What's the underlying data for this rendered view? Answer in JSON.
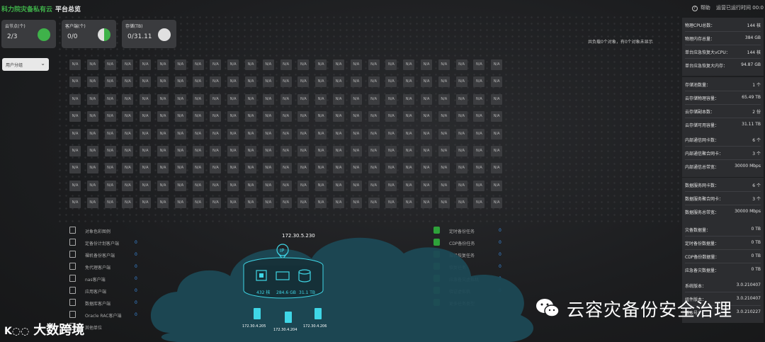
{
  "header": {
    "brand": "科力院灾备私有云",
    "subtitle": "平台总览",
    "help_label": "帮助",
    "runtime_label": "运营已运行时间 00:0"
  },
  "cards": [
    {
      "label": "云节点(个)",
      "value": "2/3",
      "pie_color": "#3fb24a",
      "pie_fraction": 1.0
    },
    {
      "label": "客户端(个)",
      "value": "0/0",
      "pie_color": "#3fb24a",
      "pie_fraction": 0.5
    },
    {
      "label": "存储(TB)",
      "value": "0/31.11",
      "pie_color": "#e0e0e0",
      "pie_fraction": 1.0
    }
  ],
  "notice": "共负载0个对象，有0个对象未显示",
  "tenant_select": {
    "value": "用户分组"
  },
  "grid": {
    "cell_label": "N/A",
    "rows": 9,
    "cols": 25
  },
  "legend_left": [
    {
      "label": "对象色彩图例",
      "count": ""
    },
    {
      "label": "定备份计划客户端",
      "count": "0"
    },
    {
      "label": "裸机备份客户端",
      "count": "0"
    },
    {
      "label": "免代理客户端",
      "count": "0"
    },
    {
      "label": "nas客户端",
      "count": "0"
    },
    {
      "label": "应用客户端",
      "count": "0"
    },
    {
      "label": "数据库客户端",
      "count": "0"
    },
    {
      "label": "Oracle RAC客户端",
      "count": "0"
    },
    {
      "label": "其他单位",
      "count": ""
    }
  ],
  "legend_right": [
    {
      "label": "定时备份任务",
      "count": "0"
    },
    {
      "label": "CDP备份任务",
      "count": "0"
    },
    {
      "label": "裸机恢复任务",
      "count": "0"
    },
    {
      "label": "恢复任务",
      "count": "0"
    },
    {
      "label": "应急备灾虚拟机",
      "count": "0"
    },
    {
      "label": "验证虚拟机",
      "count": "0"
    },
    {
      "label": "更多任务类型",
      "count": ""
    }
  ],
  "right_panel": {
    "group1": [
      {
        "k": "物理CPU总数：",
        "v": "144 核"
      },
      {
        "k": "物理内存总量：",
        "v": "384 GB"
      },
      {
        "k": "单台应急恢复大vCPU：",
        "v": "144 核"
      },
      {
        "k": "单台应急恢复大内存：",
        "v": "94.87 GB"
      }
    ],
    "group2": [
      {
        "k": "存储池数量：",
        "v": "1 个"
      },
      {
        "k": "云存储物理容量：",
        "v": "65.49 TB"
      },
      {
        "k": "云存储副本数：",
        "v": "2 份"
      },
      {
        "k": "云存储可用容量：",
        "v": "31.11 TB"
      }
    ],
    "group3": [
      {
        "k": "内部通信网卡数：",
        "v": "6 个"
      },
      {
        "k": "内部通信聚合网卡：",
        "v": "3 个"
      },
      {
        "k": "内部通信总带宽：",
        "v": "30000 Mbps"
      }
    ],
    "group4": [
      {
        "k": "数据服务网卡数：",
        "v": "6 个"
      },
      {
        "k": "数据服务聚合网卡：",
        "v": "3 个"
      },
      {
        "k": "数据服务总带宽：",
        "v": "30000 Mbps"
      }
    ],
    "group5": [
      {
        "k": "灾备数据量：",
        "v": "0 TB"
      },
      {
        "k": "定时备份数据量：",
        "v": "0 TB"
      },
      {
        "k": "CDP备份数据量：",
        "v": "0 TB"
      },
      {
        "k": "应急备灾数据量：",
        "v": "0 TB"
      }
    ],
    "group6": [
      {
        "k": "系统版本：",
        "v": "3.0.210407"
      },
      {
        "k": "组件版本：",
        "v": "3.0.210407"
      },
      {
        "k": "版本号：",
        "v": "3.0.210227"
      }
    ]
  },
  "cloud": {
    "ip": "172.30.5.230",
    "ip_badge": "IP",
    "cpu": "432 核",
    "memory": "284.6 GB",
    "storage": "31.1 TB",
    "nodes": [
      "172.30.4.205",
      "172.30.4.204",
      "172.30.4.206"
    ]
  },
  "watermark": "云容灾备份安全治理",
  "logo_text": "大数跨境",
  "colors": {
    "accent_green": "#3fb24a",
    "link_blue": "#3a8ee6",
    "cyan": "#3fd6e6"
  }
}
